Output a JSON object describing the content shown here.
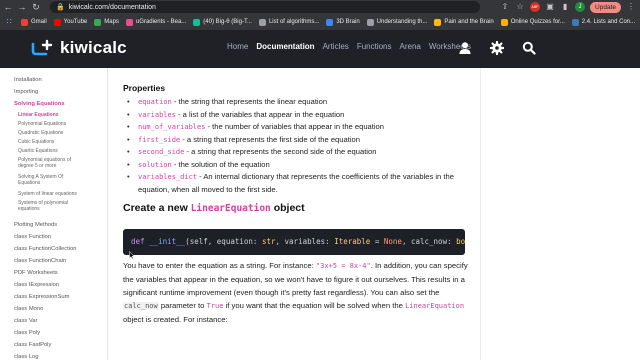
{
  "browser": {
    "url": "kiwicalc.com/documentation",
    "update_label": "Update",
    "avatar_letter": "J",
    "ext_badge": "ABP"
  },
  "bookmarks": [
    {
      "label": "Gmail",
      "color": "#ea4335"
    },
    {
      "label": "YouTube",
      "color": "#ff0000"
    },
    {
      "label": "Maps",
      "color": "#34a853"
    },
    {
      "label": "uGradients - Bea...",
      "color": "#e84f8c"
    },
    {
      "label": "(40) Big-θ (Big-T...",
      "color": "#14bf96"
    },
    {
      "label": "List of algorithms...",
      "color": "#9aa0a6"
    },
    {
      "label": "3D Brain",
      "color": "#4285f4"
    },
    {
      "label": "Understanding th...",
      "color": "#9aa0a6"
    },
    {
      "label": "Pain and the Brain",
      "color": "#fbbc05"
    },
    {
      "label": "Online Quizzes for...",
      "color": "#f4b400"
    },
    {
      "label": "2.4. Lists and Con...",
      "color": "#3d7ab8"
    }
  ],
  "site": {
    "logo_text": "kiwicalc",
    "nav": [
      "Home",
      "Documentation",
      "Articles",
      "Functions",
      "Arena",
      "Worksheets"
    ],
    "active_nav": "Documentation"
  },
  "sidebar": {
    "items": [
      {
        "label": "Installation",
        "active": false
      },
      {
        "label": "Importing",
        "active": false
      },
      {
        "label": "Solving Equations",
        "active": true
      }
    ],
    "subitems": [
      {
        "label": "Linear Equations",
        "active": true
      },
      {
        "label": "Polynomial Equations",
        "active": false
      },
      {
        "label": "Quadratic Equations",
        "active": false
      },
      {
        "label": "Cubic Equations",
        "active": false
      },
      {
        "label": "Quartic Equations",
        "active": false
      },
      {
        "label": "Polynomial equations of degree 5 or more",
        "active": false
      },
      {
        "label": "Solving A System Of Equations",
        "active": false
      },
      {
        "label": "System of linear equations",
        "active": false
      },
      {
        "label": "Systems of polynomial equations",
        "active": false
      }
    ],
    "lower": [
      "Plotting Methods",
      "class Function",
      "class FunctionCollection",
      "class FunctionChain",
      "PDF Worksheets",
      "class IExpression",
      "class ExpressionSum",
      "class Mono",
      "class Var",
      "class Poly",
      "class FastPoly",
      "class Log"
    ]
  },
  "content": {
    "properties_heading": "Properties",
    "properties": [
      {
        "name": "equation",
        "desc": " - the string that represents the linear equation"
      },
      {
        "name": "variables",
        "desc": " - a list of the variables that appear in the equation"
      },
      {
        "name": "num_of_variables",
        "desc": " - the number of variables that appear in the equation"
      },
      {
        "name": "first_side",
        "desc": " - a string that represents the first side of the equation"
      },
      {
        "name": "second_side",
        "desc": " - a string that represents the second side of the equation"
      },
      {
        "name": "solution",
        "desc": " - the solution of the equation"
      },
      {
        "name": "variables_dict",
        "desc": " - An internal dictionary that represents the coefficients of the variables in the equation, when all moved to the first side."
      }
    ],
    "create_heading_prefix": "Create a new ",
    "create_heading_code": "LinearEquation",
    "create_heading_suffix": " object",
    "code": {
      "def": "def",
      "fname": "__init__",
      "p1": "(self, equation: ",
      "t1": "str",
      "p2": ", variables: ",
      "t2": "Iterable",
      "p3": " = ",
      "n1": "None",
      "p4": ", calc_now: ",
      "t3": "boo"
    },
    "para": {
      "t1": "You have to enter the equation as a string. For instance: ",
      "c1": "\"3x+5 = 8x-4\"",
      "t2": ". In addition, you can specify the variables that appear in the equation, so we won't have to figure it out ourselves. This results in a significant runtime improvement (even though it's pretty fast regardless). You can also set the ",
      "c2": "calc_now",
      "t3": " parameter to ",
      "c3": "True",
      "t4": " if you want that the equation will be solved when the ",
      "c4": "LinearEquation",
      "t5": " object is created. For instance:"
    }
  }
}
